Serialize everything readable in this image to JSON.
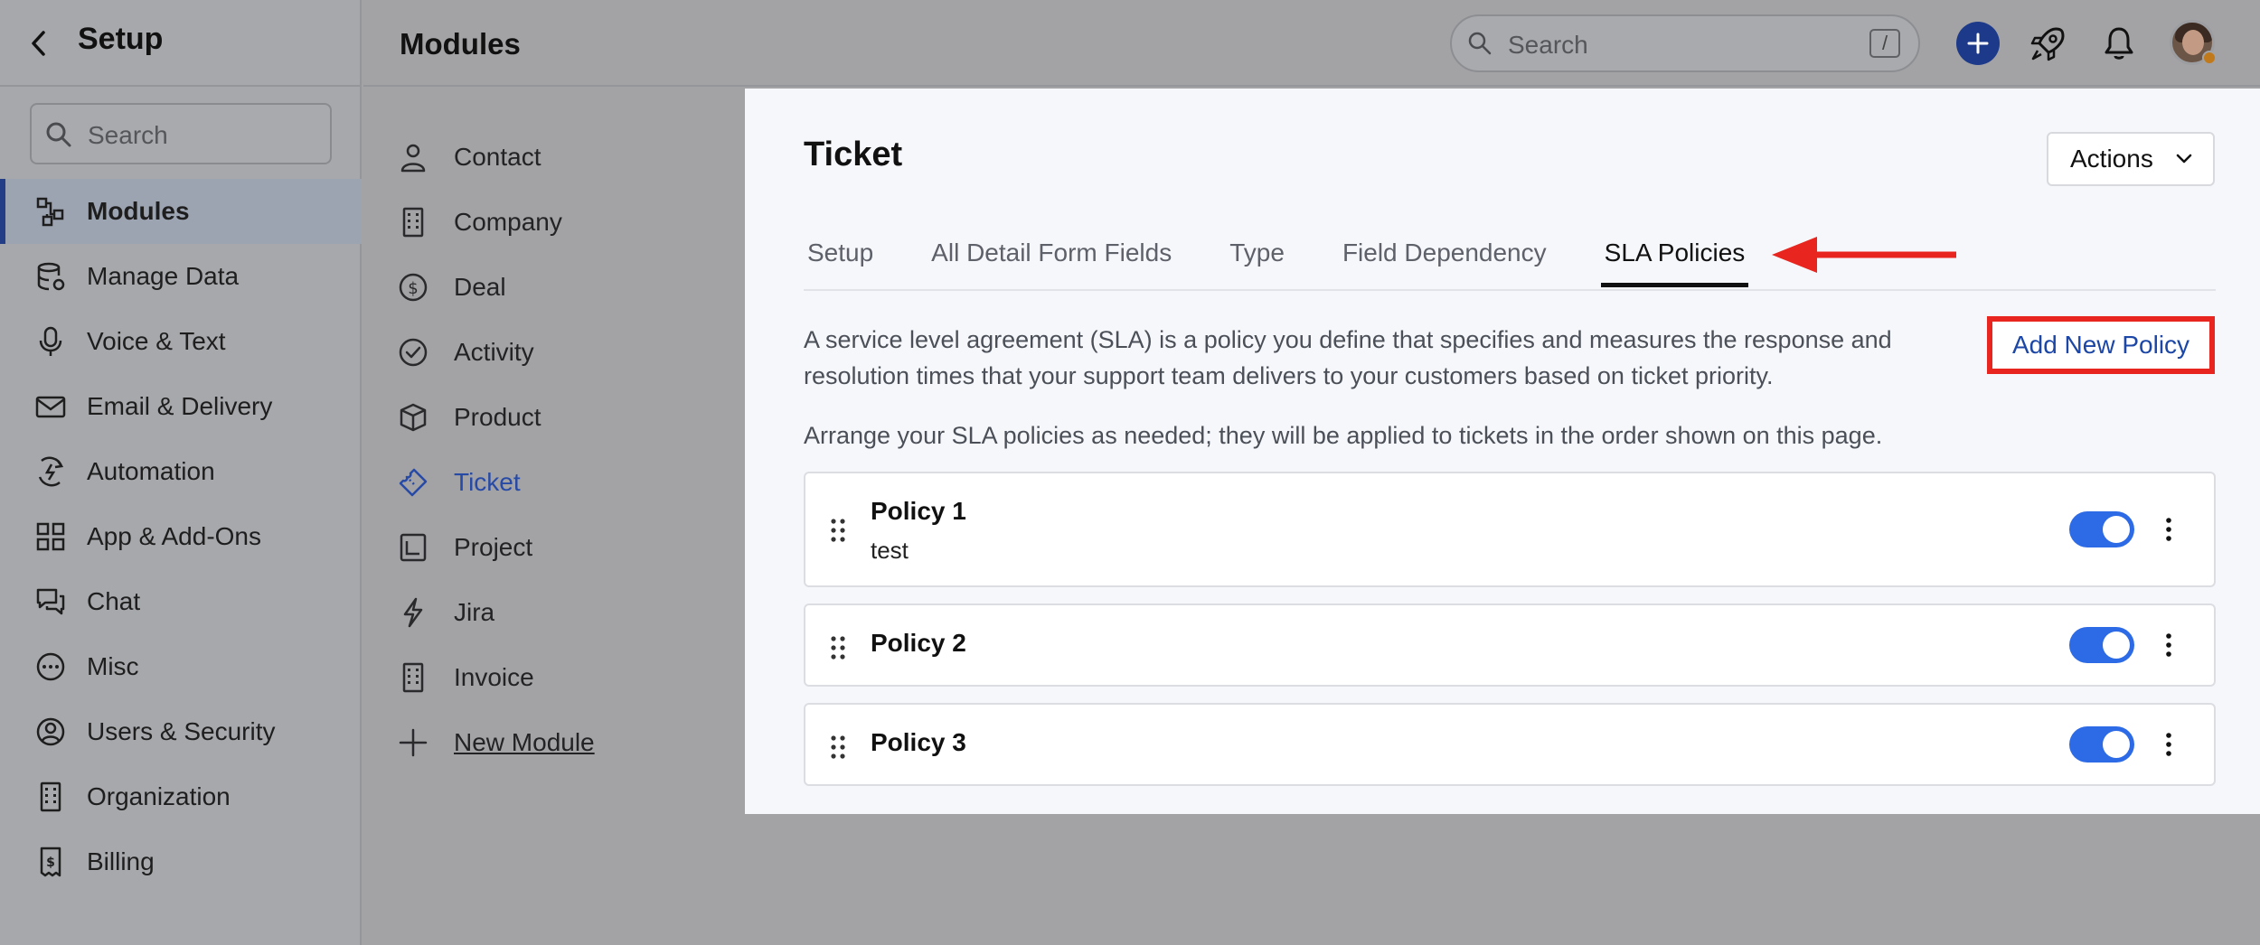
{
  "sidebar": {
    "title": "Setup",
    "search_placeholder": "Search",
    "items": [
      {
        "label": "Modules",
        "icon": "modules-icon",
        "active": true
      },
      {
        "label": "Manage Data",
        "icon": "database-icon"
      },
      {
        "label": "Voice & Text",
        "icon": "microphone-icon"
      },
      {
        "label": "Email & Delivery",
        "icon": "envelope-icon"
      },
      {
        "label": "Automation",
        "icon": "automation-icon"
      },
      {
        "label": "App & Add-Ons",
        "icon": "apps-grid-icon"
      },
      {
        "label": "Chat",
        "icon": "chat-bubbles-icon"
      },
      {
        "label": "Misc",
        "icon": "more-circle-icon"
      },
      {
        "label": "Users & Security",
        "icon": "user-circle-icon"
      },
      {
        "label": "Organization",
        "icon": "building-icon"
      },
      {
        "label": "Billing",
        "icon": "billing-icon"
      }
    ]
  },
  "topbar": {
    "title": "Modules",
    "search_placeholder": "Search",
    "search_shortcut": "/"
  },
  "modules": {
    "items": [
      {
        "label": "Contact",
        "icon": "person-icon"
      },
      {
        "label": "Company",
        "icon": "building-icon"
      },
      {
        "label": "Deal",
        "icon": "dollar-circle-icon"
      },
      {
        "label": "Activity",
        "icon": "check-circle-icon"
      },
      {
        "label": "Product",
        "icon": "box-icon"
      },
      {
        "label": "Ticket",
        "icon": "ticket-icon",
        "active": true
      },
      {
        "label": "Project",
        "icon": "project-icon"
      },
      {
        "label": "Jira",
        "icon": "lightning-icon"
      },
      {
        "label": "Invoice",
        "icon": "invoice-icon"
      },
      {
        "label": "New Module",
        "icon": "plus-icon"
      }
    ]
  },
  "panel": {
    "title": "Ticket",
    "actions_label": "Actions",
    "tabs": [
      "Setup",
      "All Detail Form Fields",
      "Type",
      "Field Dependency",
      "SLA Policies"
    ],
    "active_tab": "SLA Policies",
    "description": "A service level agreement (SLA) is a policy you define that specifies and measures the response and resolution times that your support team delivers to your customers based on ticket priority.",
    "add_button": "Add New Policy",
    "arrange_text": "Arrange your SLA policies as needed; they will be applied to tickets in the order shown on this page.",
    "policies": [
      {
        "name": "Policy 1",
        "description": "test",
        "enabled": true
      },
      {
        "name": "Policy 2",
        "description": "",
        "enabled": true
      },
      {
        "name": "Policy 3",
        "description": "",
        "enabled": true
      }
    ]
  },
  "colors": {
    "accent": "#2c6ae6",
    "link": "#1c47a6",
    "annotation_red": "#e8251f",
    "active_nav_bar": "#233d86"
  }
}
